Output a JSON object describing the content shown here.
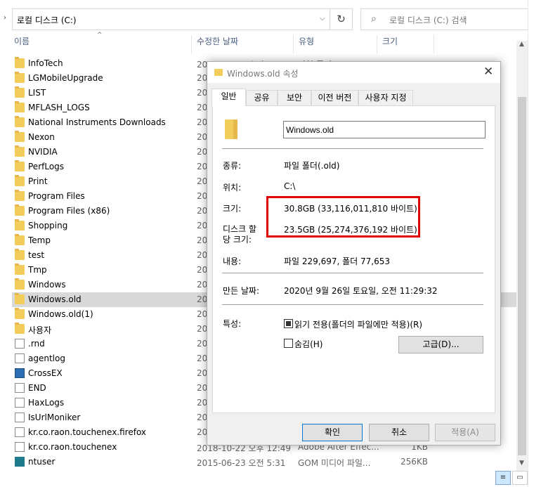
{
  "address": {
    "path": "로컬 디스크 (C:)",
    "search_placeholder": "로컬 디스크 (C:) 검색"
  },
  "columns": {
    "name": "이름",
    "date": "수정한 날짜",
    "type": "유형",
    "size": "크기"
  },
  "files": [
    {
      "name": "InfoTech",
      "date": "2020-09-20 오전 1:40",
      "type": "파일 폴더",
      "size": "",
      "icon": "folder-icon"
    },
    {
      "name": "LGMobileUpgrade",
      "date": "20",
      "type": "",
      "size": "",
      "icon": "folder-icon"
    },
    {
      "name": "LIST",
      "date": "20",
      "type": "",
      "size": "",
      "icon": "folder-icon"
    },
    {
      "name": "MFLASH_LOGS",
      "date": "20",
      "type": "",
      "size": "",
      "icon": "folder-icon"
    },
    {
      "name": "National Instruments Downloads",
      "date": "20",
      "type": "",
      "size": "",
      "icon": "folder-icon"
    },
    {
      "name": "Nexon",
      "date": "20",
      "type": "",
      "size": "",
      "icon": "folder-icon"
    },
    {
      "name": "NVIDIA",
      "date": "20",
      "type": "",
      "size": "",
      "icon": "folder-icon"
    },
    {
      "name": "PerfLogs",
      "date": "20",
      "type": "",
      "size": "",
      "icon": "folder-icon"
    },
    {
      "name": "Print",
      "date": "20",
      "type": "",
      "size": "",
      "icon": "folder-icon"
    },
    {
      "name": "Program Files",
      "date": "20",
      "type": "",
      "size": "",
      "icon": "folder-icon"
    },
    {
      "name": "Program Files (x86)",
      "date": "20",
      "type": "",
      "size": "",
      "icon": "folder-icon"
    },
    {
      "name": "Shopping",
      "date": "20",
      "type": "",
      "size": "",
      "icon": "folder-icon"
    },
    {
      "name": "Temp",
      "date": "20",
      "type": "",
      "size": "",
      "icon": "folder-icon"
    },
    {
      "name": "test",
      "date": "20",
      "type": "",
      "size": "",
      "icon": "folder-icon"
    },
    {
      "name": "Tmp",
      "date": "20",
      "type": "",
      "size": "",
      "icon": "folder-icon"
    },
    {
      "name": "Windows",
      "date": "20",
      "type": "",
      "size": "",
      "icon": "folder-icon"
    },
    {
      "name": "Windows.old",
      "date": "20",
      "type": "",
      "size": "",
      "icon": "folder-icon",
      "selected": true
    },
    {
      "name": "Windows.old(1)",
      "date": "20",
      "type": "",
      "size": "",
      "icon": "folder-icon"
    },
    {
      "name": "사용자",
      "date": "20",
      "type": "",
      "size": "",
      "icon": "folder-icon"
    },
    {
      "name": ".rnd",
      "date": "20",
      "type": "",
      "size": "",
      "icon": "file-icon"
    },
    {
      "name": "agentlog",
      "date": "20",
      "type": "",
      "size": "",
      "icon": "file-icon"
    },
    {
      "name": "CrossEX",
      "date": "20",
      "type": "",
      "size": "",
      "icon": "app-icon"
    },
    {
      "name": "END",
      "date": "20",
      "type": "",
      "size": "",
      "icon": "file-icon"
    },
    {
      "name": "HaxLogs",
      "date": "20",
      "type": "",
      "size": "",
      "icon": "file-icon"
    },
    {
      "name": "IsUrlMoniker",
      "date": "20",
      "type": "",
      "size": "",
      "icon": "file-icon"
    },
    {
      "name": "kr.co.raon.touchenex.firefox",
      "date": "20",
      "type": "",
      "size": "",
      "icon": "file-icon"
    },
    {
      "name": "kr.co.raon.touchenex",
      "date": "2018-10-22 오후 12:49",
      "type": "Adobe After Effec...",
      "size": "1KB",
      "icon": "file-icon"
    },
    {
      "name": "ntuser",
      "date": "2015-06-23 오전 5:31",
      "type": "GOM 미디어 파일...",
      "size": "256KB",
      "icon": "dat-icon"
    }
  ],
  "dialog": {
    "title": "Windows.old 속성",
    "tabs": [
      "일반",
      "공유",
      "보안",
      "이전 버전",
      "사용자 지정"
    ],
    "folder_name": "Windows.old",
    "rows": {
      "type_label": "종류:",
      "type_value": "파일 폴더(.old)",
      "location_label": "위치:",
      "location_value": "C:\\",
      "size_label": "크기:",
      "size_value": "30.8GB (33,116,011,810 바이트)",
      "disk_label_1": "디스크 할",
      "disk_label_2": "당 크기:",
      "disk_value": "23.5GB (25,274,376,192 바이트)",
      "contents_label": "내용:",
      "contents_value": "파일 229,697, 폴더 77,653",
      "created_label": "만든 날짜:",
      "created_value": "2020년 9월 26일 토요일, 오전 11:29:32",
      "attr_label": "특성:"
    },
    "readonly_label": "읽기 전용(폴더의 파일에만 적용)(R)",
    "hidden_label": "숨김(H)",
    "advanced_button": "고급(D)...",
    "ok_button": "확인",
    "cancel_button": "취소",
    "apply_button": "적용(A)"
  },
  "view": {
    "details_icon": "≡",
    "tiles_icon": "▭"
  }
}
